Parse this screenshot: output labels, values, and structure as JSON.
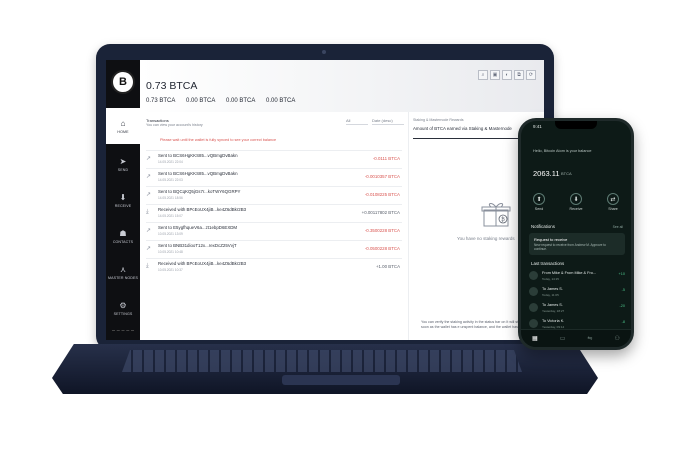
{
  "sidebar": {
    "logo": "B",
    "items": [
      {
        "icon": "home-icon",
        "glyph": "⌂",
        "label": "HOME"
      },
      {
        "icon": "send-icon",
        "glyph": "➤",
        "label": "SEND"
      },
      {
        "icon": "receive-icon",
        "glyph": "⬇",
        "label": "RECEIVE"
      },
      {
        "icon": "contacts-icon",
        "glyph": "☗",
        "label": "CONTACTS"
      },
      {
        "icon": "masternode-icon",
        "glyph": "⋏",
        "label": "MASTER NODES"
      },
      {
        "icon": "settings-icon",
        "glyph": "⚙",
        "label": "SETTINGS"
      }
    ]
  },
  "header": {
    "balance": "0.73 BTCA",
    "sub_balances": [
      "0.73 BTCA",
      "0.00 BTCA",
      "0.00 BTCA",
      "0.00 BTCA"
    ]
  },
  "transactions": {
    "title": "Transactions",
    "subtitle": "You can view your account's history",
    "filter_type": "All",
    "filter_date": "Date (desc)",
    "warning": "Please wait until the wallet is fully synced to see your correct balance",
    "rows": [
      {
        "type": "sent",
        "desc": "Sent to BCS6HgKKS85...vQBmgDvBakn",
        "date": "14.05.2021 22:04",
        "amount": "-0.0111 BTCA"
      },
      {
        "type": "sent",
        "desc": "Sent to BCS6HgKKS85...vQBmgDvBakn",
        "date": "14.05.2021 22:03",
        "amount": "-0.0010357 BTCA"
      },
      {
        "type": "sent",
        "desc": "Sent to BQCqKQ5jGs7r...koTWY6QGRPY",
        "date": "14.05.2021 18:56",
        "amount": "-0.0108225 BTCA"
      },
      {
        "type": "received",
        "desc": "Received with BPcEoUX4jiB...ke4Z6dBkr2B3",
        "date": "14.05.2021 15:07",
        "amount": "+0.00117802 BTCA"
      },
      {
        "type": "sent",
        "desc": "Sent to E5ygfhqueV6a...zt1ebpD6EXDM",
        "date": "10.05.2021 13:09",
        "amount": "-0.3500228 BTCA"
      },
      {
        "type": "sent",
        "desc": "Sent to BNB31diooT12x...rexDcZ25VvjT",
        "date": "10.05.2021 10:48",
        "amount": "-0.0500228 BTCA"
      },
      {
        "type": "received",
        "desc": "Received with BPcEoUX4jiB...ke4Z6dBkr2B3",
        "date": "10.05.2021 10:37",
        "amount": "+1.00 BTCA"
      }
    ]
  },
  "staking": {
    "title": "Staking & Masternode Rewards",
    "amount_text": "Amount of BTCA earned via Staking & Masternode",
    "empty_text": "You have no staking rewards",
    "note": "You can verify the staking activity in the status bar on It will start automatically as soon as the wallet has e unspent balance, and the wallet has"
  },
  "phone": {
    "time": "9:41",
    "greeting": "Hello, Bitcoin Atom is your balance",
    "balance": "2063.11",
    "unit": "BTCA",
    "actions": [
      {
        "icon": "send-icon",
        "glyph": "⬆",
        "label": "Send"
      },
      {
        "icon": "receive-icon",
        "glyph": "⬇",
        "label": "Receive"
      },
      {
        "icon": "share-icon",
        "glyph": "⇄",
        "label": "Share"
      }
    ],
    "notifications_label": "Notifications",
    "see_all": "See all",
    "notification": {
      "title": "Request to receive",
      "desc": "New request to receive from Andrew M. Approve to continue."
    },
    "last_tx_label": "Last transactions",
    "last_tx": [
      {
        "name": "From Mike & From Mike & Fro...",
        "sub": "Today, 14:15",
        "amount": "+10"
      },
      {
        "name": "To James S.",
        "sub": "Today, 11:05",
        "amount": "-5"
      },
      {
        "name": "To James S.",
        "sub": "Yesterday, 18:27",
        "amount": "-20"
      },
      {
        "name": "To Victoria K.",
        "sub": "Yesterday, 09:14",
        "amount": "-8"
      }
    ],
    "tabs": [
      {
        "icon": "grid-icon",
        "glyph": "▦"
      },
      {
        "icon": "wallet-icon",
        "glyph": "▭"
      },
      {
        "icon": "swap-icon",
        "glyph": "⇋"
      },
      {
        "icon": "profile-icon",
        "glyph": "⚇"
      }
    ]
  }
}
